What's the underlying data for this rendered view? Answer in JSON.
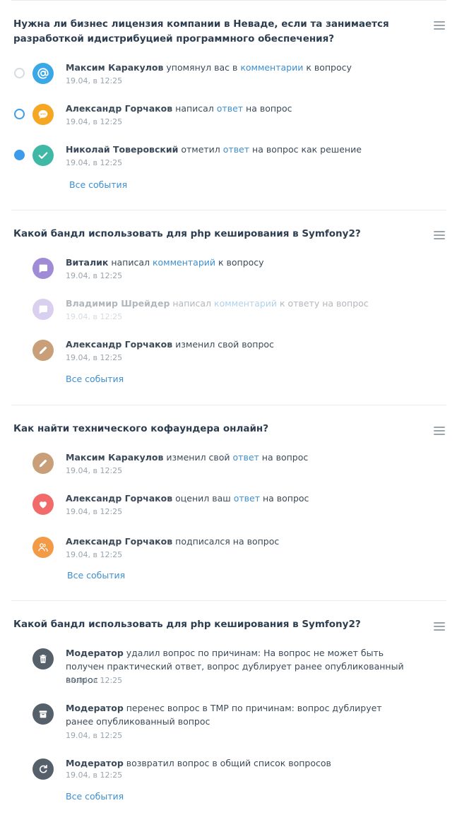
{
  "colors": {
    "link": "#3d8fd1",
    "text": "#3b4a59",
    "muted": "#9aa4ad",
    "divider": "#e9ecee"
  },
  "sections": [
    {
      "title": "Нужна ли бизнес лицензия компании в Неваде, если та занимается разработкой идистрибуцией программного обеспечения?",
      "all_events": "Все события",
      "events": [
        {
          "user": "Максим Каракулов",
          "p1": " упомянул вас в ",
          "link": "комментарии",
          "p2": " к вопросу",
          "date": "19.04, в 12:25",
          "icon": "at-icon",
          "status": "unread-hollow-grey"
        },
        {
          "user": "Александр Горчаков",
          "p1": " написал ",
          "link": "ответ",
          "p2": " на вопрос",
          "date": "19.04, в 12:25",
          "icon": "chat-bubble-icon",
          "status": "hollow-blue"
        },
        {
          "user": "Николай Товеровский",
          "p1": " отметил ",
          "link": "ответ",
          "p2": " на вопрос как решение",
          "date": "19.04, в 12:25",
          "icon": "check-icon",
          "status": "filled-blue"
        }
      ]
    },
    {
      "title": "Какой бандл использовать для php кеширования в Symfony2?",
      "all_events": "Все события",
      "events": [
        {
          "user": "Виталик",
          "p1": " написал ",
          "link": "комментарий",
          "p2": " к вопросу",
          "date": "19.04, в 12:25",
          "icon": "comment-icon"
        },
        {
          "user": "Владимир Шрейдер",
          "p1": " написал ",
          "link": "комментарий",
          "p2": " к ответу на вопрос",
          "date": "19.04, в 12:25",
          "icon": "comment-icon",
          "faded": true
        },
        {
          "user": "Александр Горчаков",
          "p1": " изменил свой вопрос",
          "link": "",
          "p2": "",
          "date": "19.04, в 12:25",
          "icon": "pencil-icon"
        }
      ]
    },
    {
      "title": "Как найти технического кофаундера онлайн?",
      "all_events": "Все события",
      "events": [
        {
          "user": "Максим Каракулов",
          "p1": " изменил свой ",
          "link": "ответ",
          "p2": " на вопрос",
          "date": "19.04, в 12:25",
          "icon": "pencil-icon"
        },
        {
          "user": "Александр Горчаков",
          "p1": " оценил ваш ",
          "link": "ответ",
          "p2": " на вопрос",
          "date": "19.04, в 12:25",
          "icon": "heart-icon"
        },
        {
          "user": "Александр Горчаков",
          "p1": " подписался на вопрос",
          "link": "",
          "p2": "",
          "date": "19.04, в 12:25",
          "icon": "subscribe-icon"
        }
      ]
    },
    {
      "title": "Какой бандл использовать для php кеширования в Symfony2?",
      "all_events": "Все события",
      "events": [
        {
          "user": "Модератор",
          "p1": " удалил вопрос по причинам: На вопрос не может быть получен практический ответ, вопрос дублирует ранее опубликованный вопрос",
          "link": "",
          "p2": "",
          "date": "19.04, в 12:25",
          "icon": "trash-icon"
        },
        {
          "user": "Модератор",
          "p1": " перенес вопрос в TMP по причинам: вопрос дублирует ранее опубликованный вопрос",
          "link": "",
          "p2": "",
          "date": "19.04, в 12:25",
          "icon": "archive-icon"
        },
        {
          "user": "Модератор",
          "p1": " возвратил вопрос в общий список вопросов",
          "link": "",
          "p2": "",
          "date": "19.04, в 12:25",
          "icon": "restore-icon"
        }
      ]
    }
  ]
}
